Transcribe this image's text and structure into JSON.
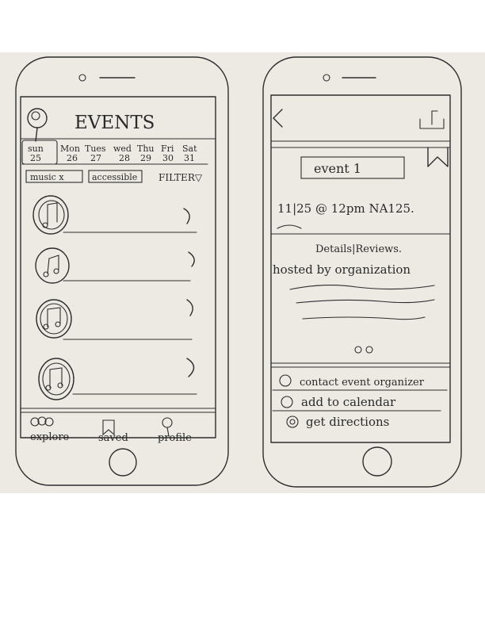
{
  "events_screen": {
    "title": "EVENTS",
    "days": [
      {
        "name": "sun",
        "date": "25",
        "selected": true
      },
      {
        "name": "Mon",
        "date": "26"
      },
      {
        "name": "Tues",
        "date": "27"
      },
      {
        "name": "wed",
        "date": "28"
      },
      {
        "name": "Thu",
        "date": "29"
      },
      {
        "name": "Fri",
        "date": "30"
      },
      {
        "name": "Sat",
        "date": "31"
      }
    ],
    "chips": [
      "music x",
      "accessible"
    ],
    "filter_label": "FILTER▽",
    "list_items": 4,
    "bottom_nav": [
      "explore",
      "saved",
      "profile"
    ]
  },
  "detail_screen": {
    "event_title": "event 1",
    "date_line": "11|25 @ 12pm NA125.",
    "tabs_line": "Details|Reviews.",
    "hosted_by": "hosted by organization",
    "actions": [
      "contact event organizer",
      "add to calendar",
      "get directions"
    ]
  },
  "colors": {
    "paper": "#edeae4",
    "ink": "#2d2d2d"
  }
}
